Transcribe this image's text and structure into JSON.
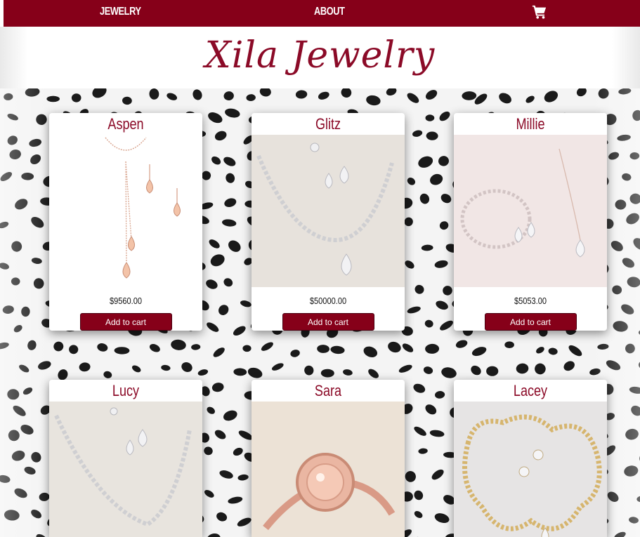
{
  "nav": {
    "jewelry_label": "Jewelry",
    "about_label": "About",
    "cart_icon": "shopping-cart-icon"
  },
  "header": {
    "brand": "Xila Jewelry"
  },
  "colors": {
    "brand": "#860019",
    "title_text": "#8b0a27",
    "background": "#f4f4f4",
    "spot": "#1a1a1a"
  },
  "products": [
    {
      "name": "Aspen",
      "price": "$9560.00",
      "button": "Add to cart"
    },
    {
      "name": "Glitz",
      "price": "$50000.00",
      "button": "Add to cart"
    },
    {
      "name": "Millie",
      "price": "$5053.00",
      "button": "Add to cart"
    },
    {
      "name": "Lucy"
    },
    {
      "name": "Sara"
    },
    {
      "name": "Lacey"
    }
  ]
}
